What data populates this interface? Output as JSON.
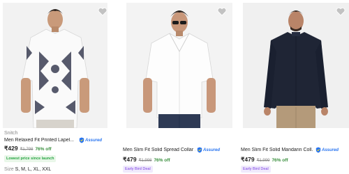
{
  "products": [
    {
      "brand": "Snitch",
      "title": "Men Relaxed Fit Printed Lapel...",
      "assured": "Assured",
      "price": "₹429",
      "mrp": "₹1,798",
      "discount": "76% off",
      "tag": "Lowest price since launch",
      "sizes_label": "Size",
      "sizes": "S, M, L, XL, XXL",
      "icons": [
        "heart-icon",
        "assured-badge-icon"
      ]
    },
    {
      "brand": "",
      "title": "Men Slim Fit Solid Spread Collar ...",
      "assured": "Assured",
      "price": "₹479",
      "mrp": "₹1,998",
      "discount": "76% off",
      "tag": "Early Bird Deal",
      "icons": [
        "heart-icon",
        "assured-badge-icon"
      ]
    },
    {
      "brand": "",
      "title": "Men Slim Fit Solid Mandarin Coll...",
      "assured": "Assured",
      "price": "₹479",
      "mrp": "₹1,999",
      "discount": "76% off",
      "tag": "Early Bird Deal",
      "icons": [
        "heart-icon",
        "assured-badge-icon"
      ]
    }
  ],
  "colors": {
    "price_text": "#212121",
    "discount_green": "#388e3c",
    "assured_blue": "#2874f0",
    "tag_green_bg": "#e9f7e9",
    "tag_purple": "#7b3fe4",
    "muted": "#878787"
  }
}
